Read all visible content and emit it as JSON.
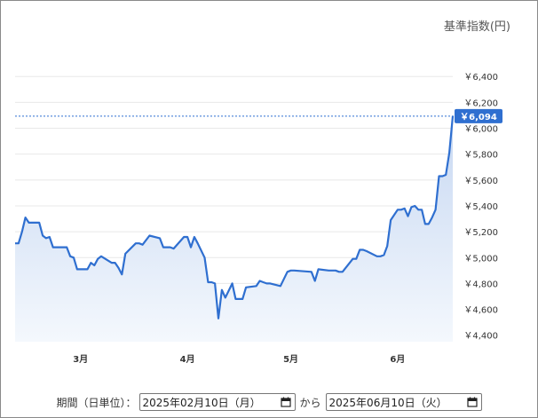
{
  "colors": {
    "line": "#2f6fd0",
    "fill_top": "#c7d8f2",
    "fill_bottom": "#f4f8fd",
    "grid": "#e8e8e8",
    "tag_bg": "#2f6fd0",
    "ref_line": "#2f6fd0"
  },
  "chart_data": {
    "type": "area",
    "ylabel": "基準指数(円)",
    "ylim": [
      4350,
      6580
    ],
    "yticks": [
      4400,
      4600,
      4800,
      5000,
      5200,
      5400,
      5600,
      5800,
      6000,
      6200,
      6400
    ],
    "ytick_labels": [
      "￥4,400",
      "￥4,600",
      "￥4,800",
      "￥5,000",
      "￥5,200",
      "￥5,400",
      "￥5,600",
      "￥5,800",
      "￥6,000",
      "￥6,200",
      "￥6,400"
    ],
    "xlim": [
      "2025-02-10",
      "2025-06-10"
    ],
    "xticks": [
      {
        "date": "2025-03-01",
        "label": "3月"
      },
      {
        "date": "2025-04-01",
        "label": "4月"
      },
      {
        "date": "2025-05-01",
        "label": "5月"
      },
      {
        "date": "2025-06-01",
        "label": "6月"
      }
    ],
    "last_value_label": "￥6,094",
    "last_value": 6094,
    "series": [
      {
        "points": [
          [
            "2025-02-10",
            5110
          ],
          [
            "2025-02-11",
            5110
          ],
          [
            "2025-02-12",
            5200
          ],
          [
            "2025-02-13",
            5310
          ],
          [
            "2025-02-14",
            5270
          ],
          [
            "2025-02-17",
            5270
          ],
          [
            "2025-02-18",
            5170
          ],
          [
            "2025-02-19",
            5150
          ],
          [
            "2025-02-20",
            5160
          ],
          [
            "2025-02-21",
            5080
          ],
          [
            "2025-02-24",
            5080
          ],
          [
            "2025-02-25",
            5080
          ],
          [
            "2025-02-26",
            5010
          ],
          [
            "2025-02-27",
            5000
          ],
          [
            "2025-02-28",
            4910
          ],
          [
            "2025-03-03",
            4910
          ],
          [
            "2025-03-04",
            4960
          ],
          [
            "2025-03-05",
            4940
          ],
          [
            "2025-03-06",
            4990
          ],
          [
            "2025-03-07",
            5010
          ],
          [
            "2025-03-10",
            4960
          ],
          [
            "2025-03-11",
            4960
          ],
          [
            "2025-03-12",
            4920
          ],
          [
            "2025-03-13",
            4870
          ],
          [
            "2025-03-14",
            5030
          ],
          [
            "2025-03-17",
            5110
          ],
          [
            "2025-03-18",
            5110
          ],
          [
            "2025-03-19",
            5100
          ],
          [
            "2025-03-21",
            5170
          ],
          [
            "2025-03-24",
            5150
          ],
          [
            "2025-03-25",
            5080
          ],
          [
            "2025-03-26",
            5080
          ],
          [
            "2025-03-27",
            5080
          ],
          [
            "2025-03-28",
            5070
          ],
          [
            "2025-03-31",
            5160
          ],
          [
            "2025-04-01",
            5160
          ],
          [
            "2025-04-02",
            5080
          ],
          [
            "2025-04-03",
            5160
          ],
          [
            "2025-04-04",
            5110
          ],
          [
            "2025-04-06",
            5000
          ],
          [
            "2025-04-07",
            4810
          ],
          [
            "2025-04-08",
            4810
          ],
          [
            "2025-04-09",
            4800
          ],
          [
            "2025-04-10",
            4530
          ],
          [
            "2025-04-11",
            4750
          ],
          [
            "2025-04-12",
            4690
          ],
          [
            "2025-04-14",
            4800
          ],
          [
            "2025-04-15",
            4680
          ],
          [
            "2025-04-16",
            4680
          ],
          [
            "2025-04-17",
            4680
          ],
          [
            "2025-04-18",
            4770
          ],
          [
            "2025-04-21",
            4780
          ],
          [
            "2025-04-22",
            4820
          ],
          [
            "2025-04-23",
            4810
          ],
          [
            "2025-04-24",
            4800
          ],
          [
            "2025-04-25",
            4800
          ],
          [
            "2025-04-28",
            4780
          ],
          [
            "2025-04-30",
            4890
          ],
          [
            "2025-05-01",
            4900
          ],
          [
            "2025-05-02",
            4900
          ],
          [
            "2025-05-07",
            4890
          ],
          [
            "2025-05-08",
            4820
          ],
          [
            "2025-05-09",
            4910
          ],
          [
            "2025-05-12",
            4900
          ],
          [
            "2025-05-13",
            4900
          ],
          [
            "2025-05-14",
            4900
          ],
          [
            "2025-05-15",
            4890
          ],
          [
            "2025-05-16",
            4890
          ],
          [
            "2025-05-19",
            4990
          ],
          [
            "2025-05-20",
            4990
          ],
          [
            "2025-05-21",
            5060
          ],
          [
            "2025-05-22",
            5060
          ],
          [
            "2025-05-23",
            5050
          ],
          [
            "2025-05-26",
            5010
          ],
          [
            "2025-05-27",
            5010
          ],
          [
            "2025-05-28",
            5020
          ],
          [
            "2025-05-29",
            5090
          ],
          [
            "2025-05-30",
            5290
          ],
          [
            "2025-06-01",
            5370
          ],
          [
            "2025-06-02",
            5370
          ],
          [
            "2025-06-03",
            5380
          ],
          [
            "2025-06-04",
            5320
          ],
          [
            "2025-06-05",
            5390
          ],
          [
            "2025-06-06",
            5400
          ],
          [
            "2025-06-07",
            5370
          ],
          [
            "2025-06-08",
            5370
          ],
          [
            "2025-06-09",
            5260
          ],
          [
            "2025-06-10",
            5260
          ],
          [
            "2025-06-11",
            5310
          ],
          [
            "2025-06-12",
            5370
          ],
          [
            "2025-06-13",
            5630
          ],
          [
            "2025-06-14",
            5630
          ],
          [
            "2025-06-15",
            5640
          ],
          [
            "2025-06-16",
            5810
          ],
          [
            "2025-06-17",
            6094
          ]
        ]
      }
    ]
  },
  "period": {
    "label": "期間（日単位）：",
    "start_date": "2025年02月10日（月）",
    "separator": "から",
    "end_date": "2025年06月10日（火）"
  }
}
